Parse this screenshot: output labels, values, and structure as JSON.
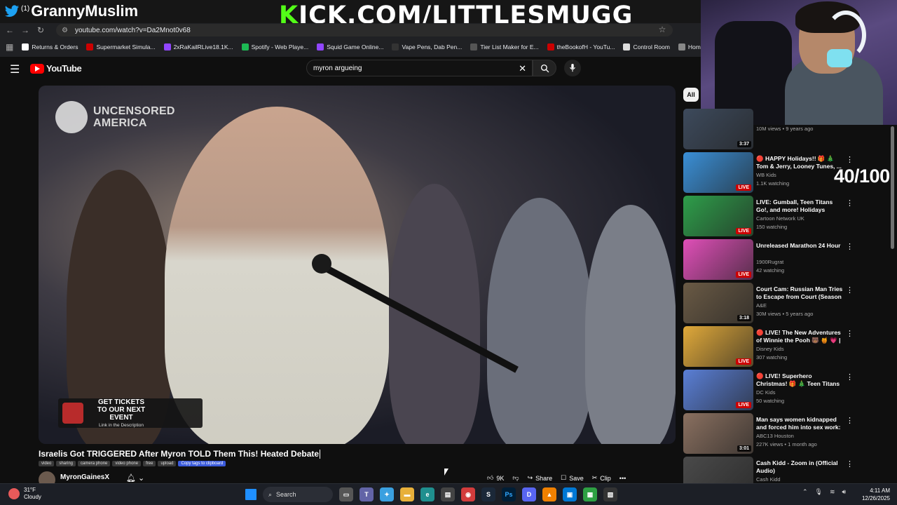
{
  "overlay": {
    "handle_superscript": "(1)",
    "handle": "GrannyMuslim",
    "banner_k": "K",
    "banner_rest": "ICK.COM/LITTLESMUGG",
    "counter": "40/100"
  },
  "browser": {
    "url": "youtube.com/watch?v=Da2Mnot0v68",
    "bookmarks": [
      {
        "label": "Returns & Orders",
        "color": "#ffffff"
      },
      {
        "label": "Supermarket Simula...",
        "color": "#cc0000"
      },
      {
        "label": "2xRaKailRLive18.1K...",
        "color": "#9146ff"
      },
      {
        "label": "Spotify - Web Playe...",
        "color": "#1db954"
      },
      {
        "label": "Squid Game Online...",
        "color": "#9146ff"
      },
      {
        "label": "Vape Pens, Dab Pen...",
        "color": "#333333"
      },
      {
        "label": "Tier List Maker for E...",
        "color": "#555555"
      },
      {
        "label": "theBookofH - YouTu...",
        "color": "#cc0000"
      },
      {
        "label": "Control Room",
        "color": "#dddddd"
      },
      {
        "label": "Home",
        "color": "#888888"
      }
    ]
  },
  "youtube": {
    "logo": "YouTube",
    "search_query": "myron argueing",
    "video": {
      "watermark": "UNCENSORED AMERICA",
      "ad_main": "GET TICKETS TO OUR NEXT EVENT",
      "ad_sub": "Link in the Description",
      "title": "Israelis Got TRIGGERED After Myron TOLD Them This! Heated Debate",
      "tags": [
        "video",
        "sharing",
        "camera phone",
        "video phone",
        "free",
        "upload"
      ],
      "copy_tags": "Copy tags to clipboard",
      "channel": "MyronGainesX",
      "likes": "9K",
      "share": "Share",
      "save": "Save",
      "clip": "Clip"
    },
    "chip_all": "All",
    "recommendations": [
      {
        "title": "",
        "channel": "",
        "meta": "10M views • 9 years ago",
        "badge": "3:37",
        "live": false,
        "thumb": "#3d4a5c"
      },
      {
        "title": "🔴 HAPPY Holidays!! 🎁 🎄 Tom & Jerry, Looney Tunes, ...",
        "channel": "WB Kids",
        "meta": "1.1K watching",
        "badge": "LIVE",
        "live": true,
        "thumb": "#3a8fd6"
      },
      {
        "title": "LIVE: Gumball, Teen Titans Go!, and more! Holidays Playlist ...",
        "channel": "Cartoon Network UK",
        "meta": "150 watching",
        "badge": "LIVE",
        "live": true,
        "thumb": "#2e9e4a"
      },
      {
        "title": "Unreleased Marathon 24 Hour",
        "channel": "1900Rugrat",
        "meta": "42 watching",
        "badge": "LIVE",
        "live": true,
        "thumb": "#e04fb8"
      },
      {
        "title": "Court Cam: Russian Man Tries to Escape from Court (Season ...",
        "channel": "A&E",
        "meta": "30M views • 5 years ago",
        "badge": "3:18",
        "live": false,
        "thumb": "#6a5a45"
      },
      {
        "title": "🔴 LIVE! The New Adventures of Winnie the Pooh 🐻 🍯 💗 | ...",
        "channel": "Disney Kids",
        "meta": "307 watching",
        "badge": "LIVE",
        "live": true,
        "thumb": "#e0a93a"
      },
      {
        "title": "🔴 LIVE! Superhero Christmas! 🎁 🎄 Teen Titans Go! Krypto ...",
        "channel": "DC Kids",
        "meta": "50 watching",
        "badge": "LIVE",
        "live": true,
        "thumb": "#5a7fd6"
      },
      {
        "title": "Man says women kidnapped and forced him into sex work: ...",
        "channel": "ABC13 Houston",
        "meta": "227K views • 1 month ago",
        "badge": "3:01",
        "live": false,
        "thumb": "#8a7060"
      },
      {
        "title": "Cash Kidd - Zoom in (Official Audio)",
        "channel": "Cash Kidd",
        "meta": "",
        "badge": "",
        "live": false,
        "thumb": "#4a4a4a"
      }
    ]
  },
  "taskbar": {
    "temp": "31°F",
    "condition": "Cloudy",
    "search": "Search",
    "time": "4:11 AM",
    "date": "12/26/2025"
  }
}
